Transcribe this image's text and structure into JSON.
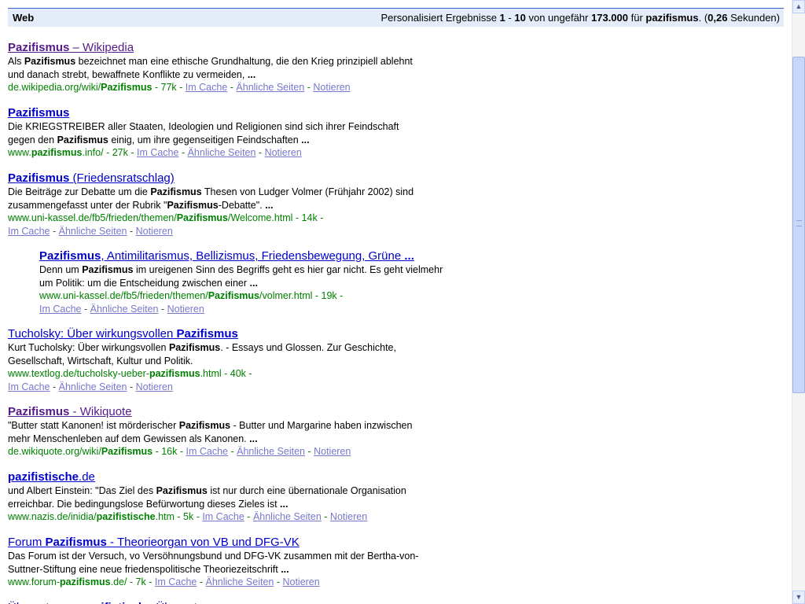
{
  "header": {
    "tab": "Web",
    "stats_prefix": "Personalisiert Ergebnisse",
    "range_start": "1",
    "range_sep": "-",
    "range_end": "10",
    "about_text": "von ungefähr",
    "total": "173.000",
    "for_text": "für",
    "query": "pazifismus",
    "time_open": ". (",
    "time": "0,26",
    "time_close": "Sekunden)"
  },
  "links": {
    "cache": "Im Cache",
    "similar": "Ähnliche Seiten",
    "note": "Notieren",
    "dash": "-"
  },
  "results": [
    {
      "title": [
        [
          "Pazifismus",
          true
        ],
        [
          " – Wikipedia",
          false
        ]
      ],
      "visited": true,
      "snippet_lines": [
        [
          [
            "Als ",
            false
          ],
          [
            "Pazifismus",
            true
          ],
          [
            " bezeichnet man eine ethische Grundhaltung, die den Krieg prinzipiell ablehnt",
            false
          ]
        ],
        [
          [
            "und danach strebt, bewaffnete Konflikte zu vermeiden, ",
            false
          ],
          [
            "...",
            true
          ]
        ]
      ],
      "url": [
        [
          "de.wikipedia.org/wiki/",
          false
        ],
        [
          "Pazifismus",
          true
        ]
      ],
      "size": "77k"
    },
    {
      "title": [
        [
          "Pazifismus",
          true
        ]
      ],
      "visited": false,
      "snippet_lines": [
        [
          [
            "Die KRIEGSTREIBER aller Staaten, Ideologien und Religionen sind sich ihrer Feindschaft",
            false
          ]
        ],
        [
          [
            "gegen den ",
            false
          ],
          [
            "Pazifismus",
            true
          ],
          [
            " einig, um ihre gegenseitigen Feindschaften ",
            false
          ],
          [
            "...",
            true
          ]
        ]
      ],
      "url": [
        [
          "www.",
          false
        ],
        [
          "pazifismus",
          true
        ],
        [
          ".info/",
          false
        ]
      ],
      "size": "27k"
    },
    {
      "title": [
        [
          "Pazifismus",
          true
        ],
        [
          " (Friedensratschlag)",
          false
        ]
      ],
      "visited": false,
      "snippet_lines": [
        [
          [
            "Die Beiträge zur Debatte um die ",
            false
          ],
          [
            "Pazifismus",
            true
          ],
          [
            " Thesen von Ludger Volmer (Frühjahr 2002) sind",
            false
          ]
        ],
        [
          [
            "zusammengefasst unter der Rubrik \"",
            false
          ],
          [
            "Pazifismus",
            true
          ],
          [
            "-Debatte\". ",
            false
          ],
          [
            "...",
            true
          ]
        ]
      ],
      "url": [
        [
          "www.uni-kassel.de/fb5/frieden/themen/",
          false
        ],
        [
          "Pazifismus",
          true
        ],
        [
          "/Welcome.html",
          false
        ]
      ],
      "size": "14k"
    },
    {
      "title": [
        [
          "Pazifismus",
          true
        ],
        [
          ", Antimilitarismus, Bellizismus, Friedensbewegung, Grüne ",
          false
        ],
        [
          "...",
          true
        ]
      ],
      "visited": false,
      "snippet_lines": [
        [
          [
            "Denn um ",
            false
          ],
          [
            "Pazifismus",
            true
          ],
          [
            " im ureigenen Sinn des Begriffs geht es hier gar nicht. Es geht vielmehr",
            false
          ]
        ],
        [
          [
            "um Politik: um die Entscheidung zwischen einer ",
            false
          ],
          [
            "...",
            true
          ]
        ]
      ],
      "url": [
        [
          "www.uni-kassel.de/fb5/frieden/themen/",
          false
        ],
        [
          "Pazifismus",
          true
        ],
        [
          "/volmer.html",
          false
        ]
      ],
      "size": "19k"
    },
    {
      "title": [
        [
          "Tucholsky: Über wirkungsvollen ",
          false
        ],
        [
          "Pazifismus",
          true
        ]
      ],
      "visited": false,
      "snippet_lines": [
        [
          [
            "Kurt Tucholsky: Über wirkungsvollen ",
            false
          ],
          [
            "Pazifismus",
            true
          ],
          [
            ". - Essays und Glossen. Zur Geschichte,",
            false
          ]
        ],
        [
          [
            "Gesellschaft, Wirtschaft, Kultur und Politik.",
            false
          ]
        ]
      ],
      "url": [
        [
          "www.textlog.de/tucholsky-ueber-",
          false
        ],
        [
          "pazifismus",
          true
        ],
        [
          ".html",
          false
        ]
      ],
      "size": "40k"
    },
    {
      "title": [
        [
          "Pazifismus",
          true
        ],
        [
          " - Wikiquote",
          false
        ]
      ],
      "visited": true,
      "snippet_lines": [
        [
          [
            "\"Butter statt Kanonen! ist mörderischer ",
            false
          ],
          [
            "Pazifismus",
            true
          ],
          [
            " - Butter und Margarine haben inzwischen",
            false
          ]
        ],
        [
          [
            "mehr Menschenleben auf dem Gewissen als Kanonen. ",
            false
          ],
          [
            "...",
            true
          ]
        ]
      ],
      "url": [
        [
          "de.wikiquote.org/wiki/",
          false
        ],
        [
          "Pazifismus",
          true
        ]
      ],
      "size": "16k"
    },
    {
      "title": [
        [
          "pazifistische",
          true
        ],
        [
          ".de",
          false
        ]
      ],
      "visited": false,
      "snippet_lines": [
        [
          [
            "und Albert Einstein: \"Das Ziel des ",
            false
          ],
          [
            "Pazifismus",
            true
          ],
          [
            " ist nur durch eine übernationale Organisation",
            false
          ]
        ],
        [
          [
            "erreichbar. Die bedingungslose Befürwortung dieses Zieles ist ",
            false
          ],
          [
            "...",
            true
          ]
        ]
      ],
      "url": [
        [
          "www.nazis.de/inidia/",
          false
        ],
        [
          "pazifistische",
          true
        ],
        [
          ".htm",
          false
        ]
      ],
      "size": "5k"
    },
    {
      "title": [
        [
          "Forum ",
          false
        ],
        [
          "Pazifismus",
          true
        ],
        [
          " - Theorieorgan von VB und DFG-VK",
          false
        ]
      ],
      "visited": false,
      "snippet_lines": [
        [
          [
            "Das Forum ist der Versuch, vo Versöhnungsbund und DFG-VK zusammen mit der Bertha-von-",
            false
          ]
        ],
        [
          [
            "Suttner-Stiftung eine neue friedenspolitische Theoriezeitschrift ",
            false
          ],
          [
            "...",
            true
          ]
        ]
      ],
      "url": [
        [
          "www.forum-",
          false
        ],
        [
          "pazifismus",
          true
        ],
        [
          ".de/",
          false
        ]
      ],
      "size": "7k"
    }
  ],
  "partial_result": {
    "title": [
      [
        "Übersetzung: ",
        false
      ],
      [
        "pazifistisch",
        true
      ],
      [
        " - Übersetzung",
        false
      ]
    ]
  },
  "scrollbar": {
    "up_icon": "▲",
    "down_icon": "▼",
    "position": 0.09
  }
}
